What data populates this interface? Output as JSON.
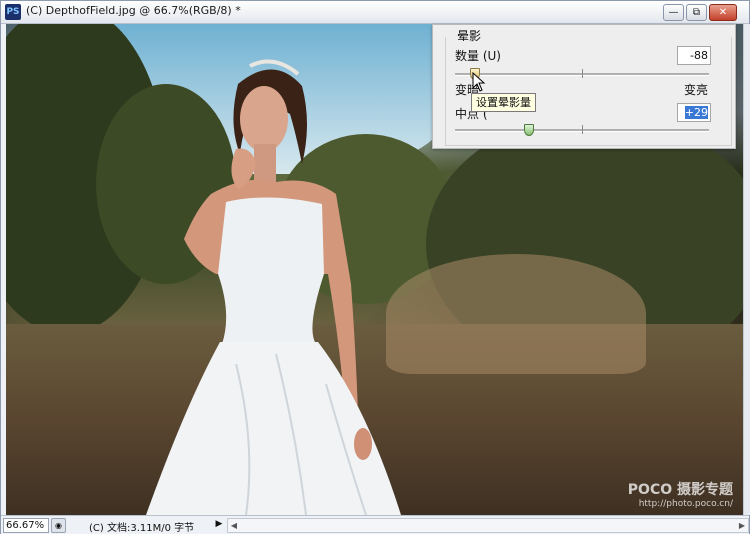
{
  "window": {
    "app_icon": "PS",
    "title": "(C) DepthofField.jpg @ 66.7%(RGB/8) *",
    "buttons": {
      "minimize": "—",
      "restore": "⧉",
      "close": "✕"
    }
  },
  "canvas": {
    "image_description_icon": "photo",
    "watermark": {
      "brand": "POCO 摄影专题",
      "url": "http://photo.poco.cn/"
    }
  },
  "vignette_panel": {
    "group_title": "晕影",
    "amount_label": "数量 (U)",
    "amount_value": "-88",
    "amount_slider_fraction": 0.08,
    "darken_label": "变暗",
    "lighten_label": "变亮",
    "midpoint_label": "中点 (",
    "midpoint_value": "+29",
    "midpoint_slider_fraction": 0.29
  },
  "tooltip": {
    "text": "设置晕影量"
  },
  "statusbar": {
    "zoom": "66.67%",
    "doc_info": "(C) 文档:3.11M/0 字节",
    "arrow": "▶",
    "scroll_left": "◀",
    "scroll_right": "▶"
  }
}
